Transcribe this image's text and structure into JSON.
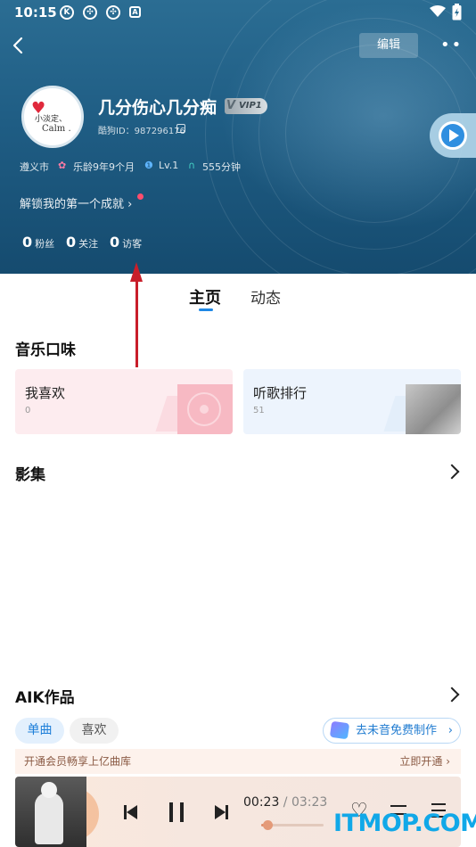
{
  "status_bar": {
    "time": "10:15",
    "icons": [
      "kugou-k-icon",
      "app-icon",
      "app-icon",
      "a-icon",
      "wifi-icon",
      "battery-icon"
    ]
  },
  "header": {
    "edit_label": "编辑",
    "more_label": "••",
    "nickname": "几分伤心几分痴",
    "vip_level": "VIP1",
    "kugou_id": "酷狗ID：987296176",
    "avatar_text_line1": "小淡定、",
    "avatar_text_line2": "Calm .",
    "meta": {
      "city": "遵义市",
      "music_age": "乐龄9年9个月",
      "level": "Lv.1",
      "listen_time": "555分钟"
    },
    "achievement": "解锁我的第一个成就",
    "stats": [
      {
        "num": "0",
        "label": "粉丝"
      },
      {
        "num": "0",
        "label": "关注"
      },
      {
        "num": "0",
        "label": "访客"
      }
    ]
  },
  "tabs": [
    {
      "label": "主页",
      "active": true
    },
    {
      "label": "动态",
      "active": false
    }
  ],
  "music_taste": {
    "title": "音乐口味",
    "cards": [
      {
        "title": "我喜欢",
        "count": "0"
      },
      {
        "title": "听歌排行",
        "count": "51"
      }
    ]
  },
  "album_section": {
    "title": "影集"
  },
  "aik_section": {
    "title": "AIK作品",
    "chips": [
      {
        "label": "单曲",
        "active": true
      },
      {
        "label": "喜欢",
        "active": false
      }
    ],
    "promo": "去未音免费制作"
  },
  "vip_bar": {
    "left": "开通会员畅享上亿曲库",
    "right": "立即开通 ›"
  },
  "player": {
    "current_time": "00:23",
    "separator": " / ",
    "total_time": "03:23",
    "progress_fraction": 0.11
  },
  "watermark": "ITMOP.COM",
  "colors": {
    "accent": "#1e88e5",
    "header_bg": "#1f5d84",
    "annotation_arrow": "#c81e2a"
  }
}
